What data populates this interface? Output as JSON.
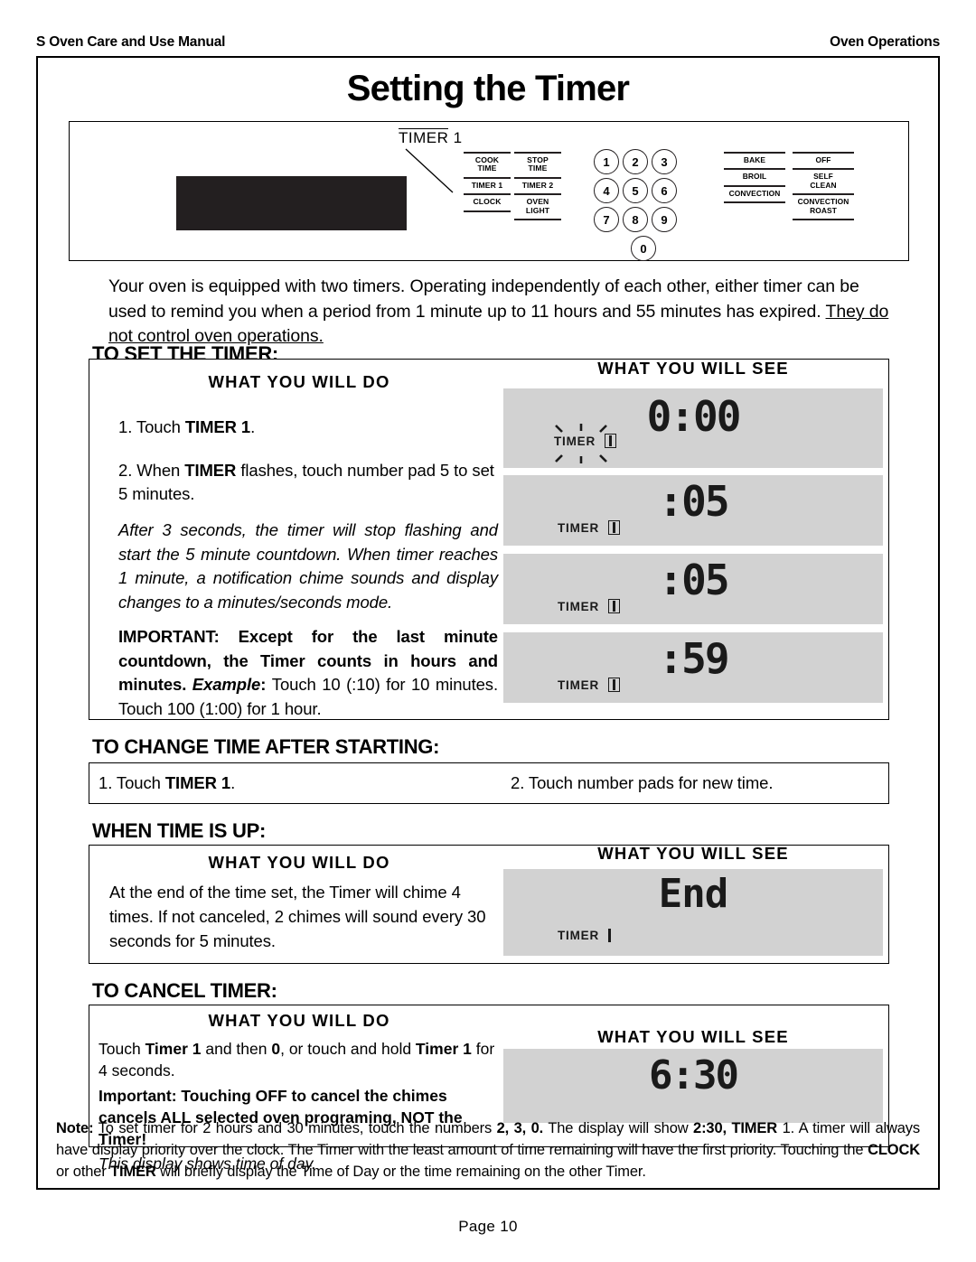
{
  "runhead": {
    "left": "S Oven Care and Use Manual",
    "right": "Oven Operations"
  },
  "title": "Setting the Timer",
  "control_panel": {
    "callout_label": "TIMER",
    "callout_number": "1",
    "left_buttons": [
      [
        "COOK TIME",
        "STOP TIME"
      ],
      [
        "TIMER 1",
        "TIMER 2"
      ],
      [
        "CLOCK",
        "OVEN LIGHT"
      ]
    ],
    "buttons_col1": [
      "COOK\nTIME",
      "TIMER 1",
      "CLOCK"
    ],
    "buttons_col2": [
      "STOP\nTIME",
      "TIMER 2",
      "OVEN\nLIGHT"
    ],
    "buttons_col3": [
      "BAKE",
      "BROIL",
      "CONVECTION"
    ],
    "buttons_col4": [
      "OFF",
      "SELF\nCLEAN",
      "CONVECTION\nROAST"
    ],
    "keypad": [
      "1",
      "2",
      "3",
      "4",
      "5",
      "6",
      "7",
      "8",
      "9",
      "0"
    ]
  },
  "intro": {
    "line1": "Your oven is equipped with two timers.  Operating independently of each other, either timer",
    "line2": "can be used to remind you when a period from 1 minute up to 11 hours and 55 minutes has",
    "line3_plain": "expired.  ",
    "line3_underline": "They do not control oven operations."
  },
  "headings": {
    "to_set": "TO SET THE TIMER:",
    "to_change": "TO CHANGE TIME AFTER STARTING:",
    "when_up": "WHEN TIME IS UP:",
    "to_cancel": "TO CANCEL TIMER:"
  },
  "col_headers": {
    "will_do": "WHAT  YOU  WILL DO",
    "will_see": "WHAT  YOU  WILL SEE"
  },
  "to_set": {
    "step1_pre": "1.  Touch ",
    "step1_bold": "TIMER 1",
    "step1_post": ".",
    "step2_pre": "2.  When ",
    "step2_bold": "TIMER",
    "step2_post": " flashes, touch number pad 5 to set 5 minutes.",
    "italic_note": "After 3 seconds, the timer will stop flashing and start the 5 minute countdown.  When timer reaches 1 minute, a notification chime sounds and display changes to a minutes/seconds mode.",
    "important_bold": "IMPORTANT: Except for the last minute countdown, the Timer counts in hours and minutes. ",
    "important_example": "Example",
    "important_colon": ": ",
    "important_rest": "Touch 10 (:10) for 10 minutes. Touch 100 (1:00) for 1 hour.",
    "displays": [
      {
        "value": "0:00",
        "timer_label": "TIMER",
        "timer_num": "1",
        "flashing": "true"
      },
      {
        "value": ":05",
        "timer_label": "TIMER",
        "timer_num": "1",
        "flashing": "false"
      },
      {
        "value": ":05",
        "timer_label": "TIMER",
        "timer_num": "1",
        "flashing": "false"
      },
      {
        "value": ":59",
        "timer_label": "TIMER",
        "timer_num": "1",
        "flashing": "false"
      }
    ]
  },
  "to_change": {
    "step1_pre": "1.  Touch ",
    "step1_bold": "TIMER 1",
    "step1_post": ".",
    "step2": "2.  Touch number pads for new time."
  },
  "when_up": {
    "italic_note": "At the end of the time set, the Timer will  chime 4 times.  If not canceled, 2 chimes will sound every 30 seconds for 5 minutes.",
    "display": {
      "value": "End",
      "timer_label": "TIMER",
      "timer_num": "1"
    }
  },
  "to_cancel": {
    "line1_a": "Touch ",
    "line1_b": "Timer 1",
    "line1_c": " and then ",
    "line1_d": "0",
    "line1_e": ", or touch and hold ",
    "line1_f": "Timer 1",
    "line1_g": " for 4 seconds.",
    "important": "Important:  Touching OFF to cancel the chimes cancels  ALL selected oven programing, NOT the Timer!",
    "footnote": "This display shows time of day.",
    "display": {
      "value": "6:30"
    }
  },
  "note": {
    "label": "Note:",
    "t1": " To set timer for 2 hours and 30 minutes, touch the numbers ",
    "b1": "2, 3, 0.",
    "t2": "  The display will show ",
    "b2": "2:30, TIMER",
    "t3": " 1. A timer will always have display priority over the clock.  The Timer with the least amount of time remaining will have the first priority.  Touching the ",
    "b3": "CLOCK",
    "t4": " or other ",
    "b4": "TIMER",
    "t5": " will briefly display the Time of Day or the time remaining on the other Timer."
  },
  "footer": "Page 10",
  "colors": {
    "lcd_background": "#d2d2d2",
    "lcd_panel": "#231f20",
    "ink": "#000000"
  }
}
